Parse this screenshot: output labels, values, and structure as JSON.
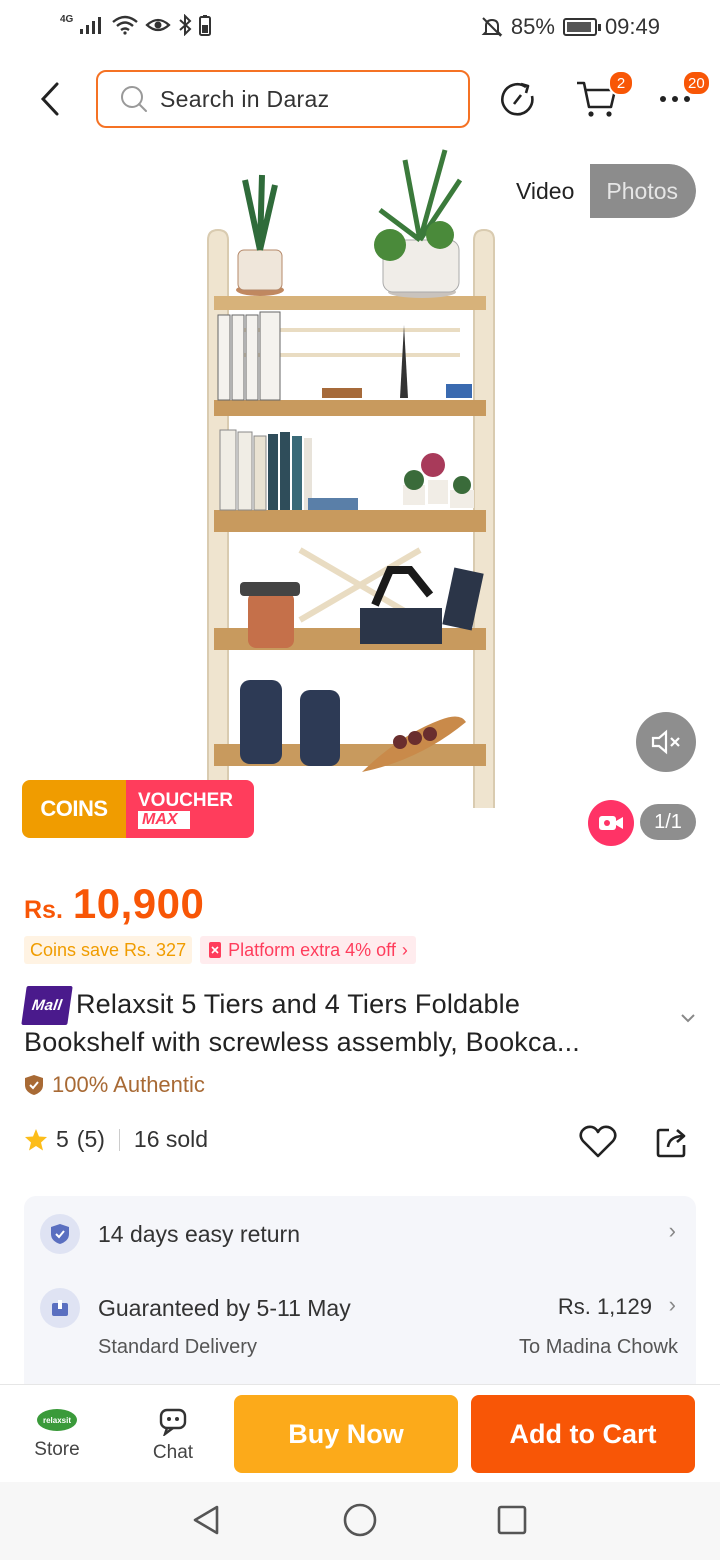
{
  "status_bar": {
    "network": "4G",
    "battery": "85%",
    "time": "09:49"
  },
  "header": {
    "search_placeholder": "Search in Daraz",
    "cart_badge": "2",
    "more_badge": "20"
  },
  "gallery": {
    "toggle_video": "Video",
    "toggle_photos": "Photos",
    "counter": "1/1",
    "coins_label": "COINS",
    "voucher_label": "VOUCHER",
    "voucher_sub": "MAX"
  },
  "product": {
    "currency": "Rs.",
    "price": "10,900",
    "coins_save": "Coins save Rs. 327",
    "platform_offer": "Platform extra 4% off",
    "mall_badge": "Mall",
    "title_line1": "Relaxsit 5 Tiers and 4 Tiers Foldable",
    "title_line2": "Bookshelf with screwless assembly, Bookca...",
    "authentic": "100% Authentic",
    "rating": "5",
    "rating_count": "(5)",
    "sold": "16 sold"
  },
  "services": {
    "return_text": "14 days easy return",
    "delivery_title": "Guaranteed by 5-11 May",
    "delivery_type": "Standard Delivery",
    "delivery_price": "Rs. 1,129",
    "delivery_location": "To Madina Chowk"
  },
  "actions": {
    "store_label": "Store",
    "store_logo_text": "relaxsit",
    "chat_label": "Chat",
    "buy_now": "Buy Now",
    "add_to_cart": "Add to Cart"
  },
  "colors": {
    "brand_orange": "#f85606",
    "buy_now_yellow": "#fcaa1a",
    "coins_orange": "#f09c00",
    "voucher_pink": "#ff3d5c",
    "mall_purple": "#4a1a8c"
  }
}
